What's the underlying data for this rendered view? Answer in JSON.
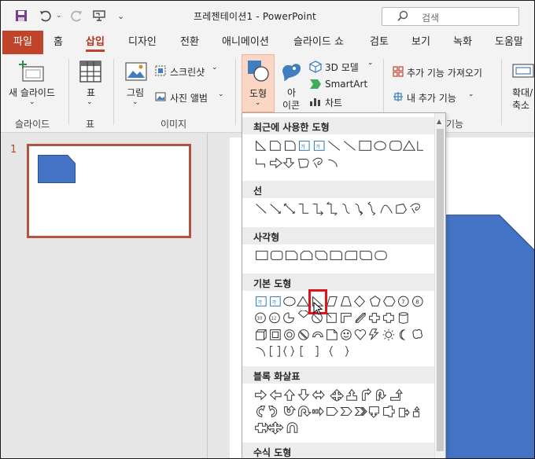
{
  "window": {
    "title": "프레젠테이션1 - PowerPoint",
    "search_placeholder": "검색"
  },
  "tabs": [
    {
      "label": "파일"
    },
    {
      "label": "홈"
    },
    {
      "label": "삽입"
    },
    {
      "label": "디자인"
    },
    {
      "label": "전환"
    },
    {
      "label": "애니메이션"
    },
    {
      "label": "슬라이드 쇼"
    },
    {
      "label": "검토"
    },
    {
      "label": "보기"
    },
    {
      "label": "녹화"
    },
    {
      "label": "도움말"
    }
  ],
  "ribbon": {
    "new_slide_label": "새 슬라이드",
    "table_label": "표",
    "picture_label": "그림",
    "screenshot_label": "스크린샷",
    "photo_album_label": "사진 앨범",
    "shapes_label": "도형",
    "icons_label_1": "아",
    "icons_label_2": "이콘",
    "model3d_label": "3D 모델",
    "smartart_label": "SmartArt",
    "chart_label": "차트",
    "get_addins_label": "추가 기능 가져오기",
    "my_addins_label": "내 추가 기능",
    "zoom_label_1": "확대/",
    "zoom_label_2": "축소",
    "groups": {
      "slides": "슬라이드",
      "tables": "표",
      "images": "이미지",
      "addins_partial": "기능"
    }
  },
  "thumbnails": {
    "slide_number": "1"
  },
  "shapes_menu": {
    "categories": [
      {
        "label": "최근에 사용한 도형"
      },
      {
        "label": "선"
      },
      {
        "label": "사각형"
      },
      {
        "label": "기본 도형"
      },
      {
        "label": "블록 화살표"
      },
      {
        "label": "수식 도형"
      }
    ]
  },
  "colors": {
    "accent": "#c0442a",
    "shape_fill": "#4472c4",
    "highlight": "#e0141b"
  }
}
